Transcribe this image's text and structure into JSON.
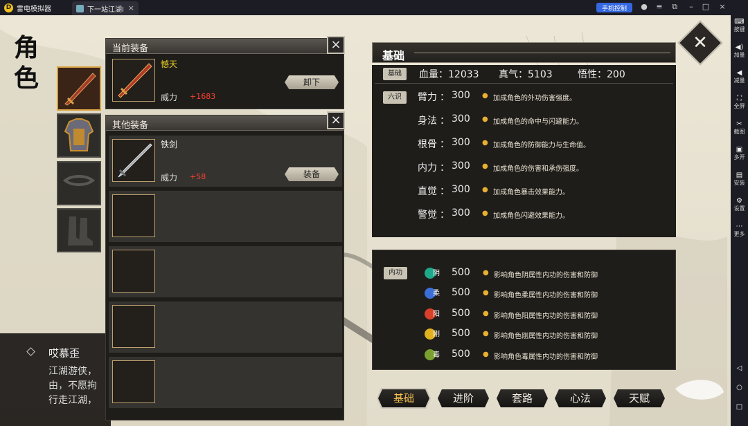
{
  "emulator": {
    "app_name": "雷电模拟器",
    "tab_title": "下一站江湖Ⅰ",
    "phone_control": "手机控制"
  },
  "sidebar": {
    "items": [
      {
        "label": "按键",
        "icon": "keyboard-icon"
      },
      {
        "label": "加量",
        "icon": "volume-up-icon"
      },
      {
        "label": "减量",
        "icon": "volume-down-icon"
      },
      {
        "label": "全屏",
        "icon": "fullscreen-icon"
      },
      {
        "label": "截图",
        "icon": "scissors-icon"
      },
      {
        "label": "多开",
        "icon": "multi-instance-icon"
      },
      {
        "label": "安装",
        "icon": "install-icon"
      },
      {
        "label": "设置",
        "icon": "gear-icon"
      },
      {
        "label": "更多",
        "icon": "more-icon"
      }
    ]
  },
  "page": {
    "title_chars": [
      "角",
      "色"
    ]
  },
  "hero": {
    "name": "哎慕歪",
    "desc_lines": [
      "江湖游侠，",
      "由，不愿拘",
      "行走江湖，"
    ]
  },
  "equipment": {
    "current_header": "当前装备",
    "other_header": "其他装备",
    "current": {
      "name": "憾天",
      "power_label": "威力",
      "power_value": "+1683",
      "button": "卸下"
    },
    "other": {
      "name": "铁剑",
      "power_label": "威力",
      "power_value": "+58",
      "button": "装备"
    }
  },
  "stats": {
    "title": "基础",
    "base_tag": "基础",
    "base": [
      {
        "label": "血量",
        "value": "12033"
      },
      {
        "label": "真气",
        "value": "5103"
      },
      {
        "label": "悟性",
        "value": "200"
      }
    ],
    "six_tag": "六识",
    "six": [
      {
        "name": "臂力",
        "value": "300",
        "desc": "加成角色的外功伤害强度。"
      },
      {
        "name": "身法",
        "value": "300",
        "desc": "加成角色的命中与闪避能力。"
      },
      {
        "name": "根骨",
        "value": "300",
        "desc": "加成角色的防御能力与生命值。"
      },
      {
        "name": "内力",
        "value": "300",
        "desc": "加成角色的伤害和承伤强度。"
      },
      {
        "name": "直觉",
        "value": "300",
        "desc": "加成角色暴击效果能力。"
      },
      {
        "name": "警觉",
        "value": "300",
        "desc": "加成角色闪避效果能力。"
      }
    ],
    "inner_tag": "内功",
    "inner": [
      {
        "char": "阴",
        "value": "500",
        "desc": "影响角色阴属性内功的伤害和防御",
        "color": "#1fa88a"
      },
      {
        "char": "柔",
        "value": "500",
        "desc": "影响角色柔属性内功的伤害和防御",
        "color": "#3a6fd8"
      },
      {
        "char": "阳",
        "value": "500",
        "desc": "影响角色阳属性内功的伤害和防御",
        "color": "#d8402a"
      },
      {
        "char": "刚",
        "value": "500",
        "desc": "影响角色刚属性内功的伤害和防御",
        "color": "#e0b020"
      },
      {
        "char": "毒",
        "value": "500",
        "desc": "影响角色毒属性内功的伤害和防御",
        "color": "#7aa030"
      }
    ]
  },
  "tabs": [
    "基础",
    "进阶",
    "套路",
    "心法",
    "天赋"
  ],
  "colors": {
    "accent_gold": "#f5c050",
    "power_red": "#ff4030",
    "panel_dark": "#1f1d1a"
  }
}
